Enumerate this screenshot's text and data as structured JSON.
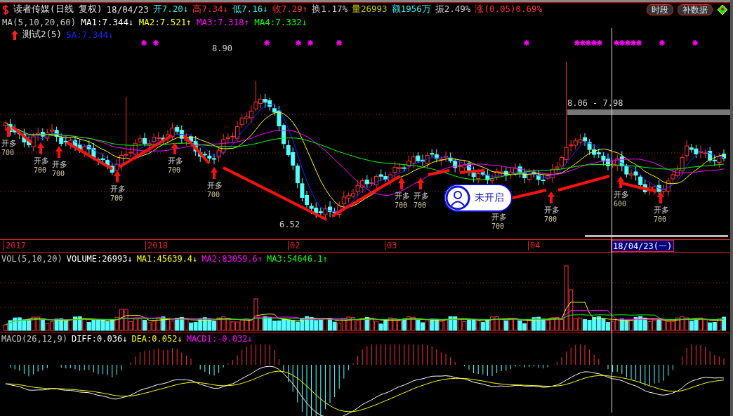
{
  "header": {
    "stock": "读者传媒(日线 复权)",
    "date": "18/04/23",
    "quotes": [
      {
        "text": "开7.20↓",
        "color": "#33eeee"
      },
      {
        "text": "高7.34↓",
        "color": "#ff3333"
      },
      {
        "text": "低7.16↓",
        "color": "#33eeee"
      },
      {
        "text": "收7.29↑",
        "color": "#ff3333"
      },
      {
        "text": "换1.17%",
        "color": "#c8c8c8"
      },
      {
        "text": "量26993",
        "color": "#c8c800"
      },
      {
        "text": "额1956万",
        "color": "#33eeee"
      },
      {
        "text": "振2.49%",
        "color": "#c8c8c8"
      },
      {
        "text": "涨(0.05)0.69%",
        "color": "#ff3333"
      }
    ]
  },
  "buttons": [
    {
      "label": "时段"
    },
    {
      "label": "补数据"
    }
  ],
  "ma_legend": [
    {
      "text": "MA(5,10,20,60)",
      "color": "#c8c8c8"
    },
    {
      "text": "MA1:7.344↓",
      "color": "#ffffff"
    },
    {
      "text": "MA2:7.521↑",
      "color": "#ffff00"
    },
    {
      "text": "MA3:7.318↑",
      "color": "#ff00ff"
    },
    {
      "text": "MA4:7.332↓",
      "color": "#00ff00"
    }
  ],
  "indicator": {
    "name": "测试2(5)",
    "value": {
      "text": "SA:7.344↓",
      "color": "#2222ff"
    }
  },
  "price_labels": [
    "8.90",
    "6.52",
    "8.06 - 7.98"
  ],
  "signals": [
    {
      "action": "开多",
      "qty": "700"
    },
    {
      "action": "开多",
      "qty": "700"
    },
    {
      "action": "开多",
      "qty": "700"
    },
    {
      "action": "开多",
      "qty": "700"
    },
    {
      "action": "开多",
      "qty": "700"
    },
    {
      "action": "开多",
      "qty": "700"
    },
    {
      "action": "开多",
      "qty": "700"
    },
    {
      "action": "开多",
      "qty": "700"
    },
    {
      "action": "开多",
      "qty": "700"
    },
    {
      "action": "开多",
      "qty": "700"
    },
    {
      "action": "开多",
      "qty": "600"
    },
    {
      "action": "开多",
      "qty": "700"
    }
  ],
  "time_axis": {
    "labels": [
      "2017",
      "2018",
      "02",
      "03",
      "04"
    ],
    "cursor_date": "18/04/23(一)"
  },
  "overlay": {
    "label": "未开启"
  },
  "volume_legend": [
    {
      "text": "VOL(5,10,20)",
      "color": "#c8c8c8"
    },
    {
      "text": "VOLUME:26993↓",
      "color": "#ffffff"
    },
    {
      "text": "MA1:45639.4↓",
      "color": "#ffff00"
    },
    {
      "text": "MA2:83059.6↑",
      "color": "#ff00ff"
    },
    {
      "text": "MA3:54646.1↑",
      "color": "#00ff00"
    }
  ],
  "macd_legend": [
    {
      "text": "MACD(26,12,9)",
      "color": "#c8c8c8"
    },
    {
      "text": "DIFF:0.036↓",
      "color": "#ffffff"
    },
    {
      "text": "DEA:0.052↓",
      "color": "#ffff00"
    },
    {
      "text": "MACD1:-0.032↓",
      "color": "#ff00ff"
    }
  ]
}
